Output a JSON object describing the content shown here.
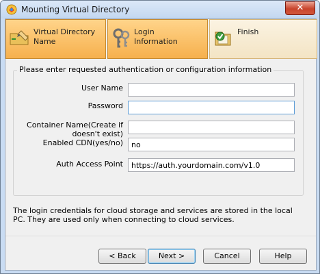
{
  "window": {
    "title": "Mounting Virtual Directory",
    "close_label": "✕"
  },
  "steps": [
    {
      "label": "Virtual Directory\nName",
      "icon": "folder-pencil-icon"
    },
    {
      "label": "Login\nInformation",
      "icon": "keys-icon"
    },
    {
      "label": "Finish",
      "icon": "folder-check-icon"
    }
  ],
  "group": {
    "legend": "Please enter requested authentication or configuration information"
  },
  "form": {
    "user_name_label": "User Name",
    "user_name_value": "",
    "password_label": "Password",
    "password_value": "",
    "container_label_line1": "Container Name(Create if",
    "container_label_line2": "doesn't exist)",
    "container_value": "",
    "cdn_label": "Enabled CDN(yes/no)",
    "cdn_value": "no",
    "auth_label": "Auth Access Point",
    "auth_value": "https://auth.yourdomain.com/v1.0"
  },
  "info_text": "The login credentials for cloud storage and services are stored in the local PC. They are used only when connecting to cloud services.",
  "buttons": {
    "back": "< Back",
    "next": "Next >",
    "cancel": "Cancel",
    "help": "Help"
  },
  "colors": {
    "tab_active": "#f6b04d",
    "tab_inactive": "#f3e4c4",
    "close_button": "#c8442c"
  }
}
